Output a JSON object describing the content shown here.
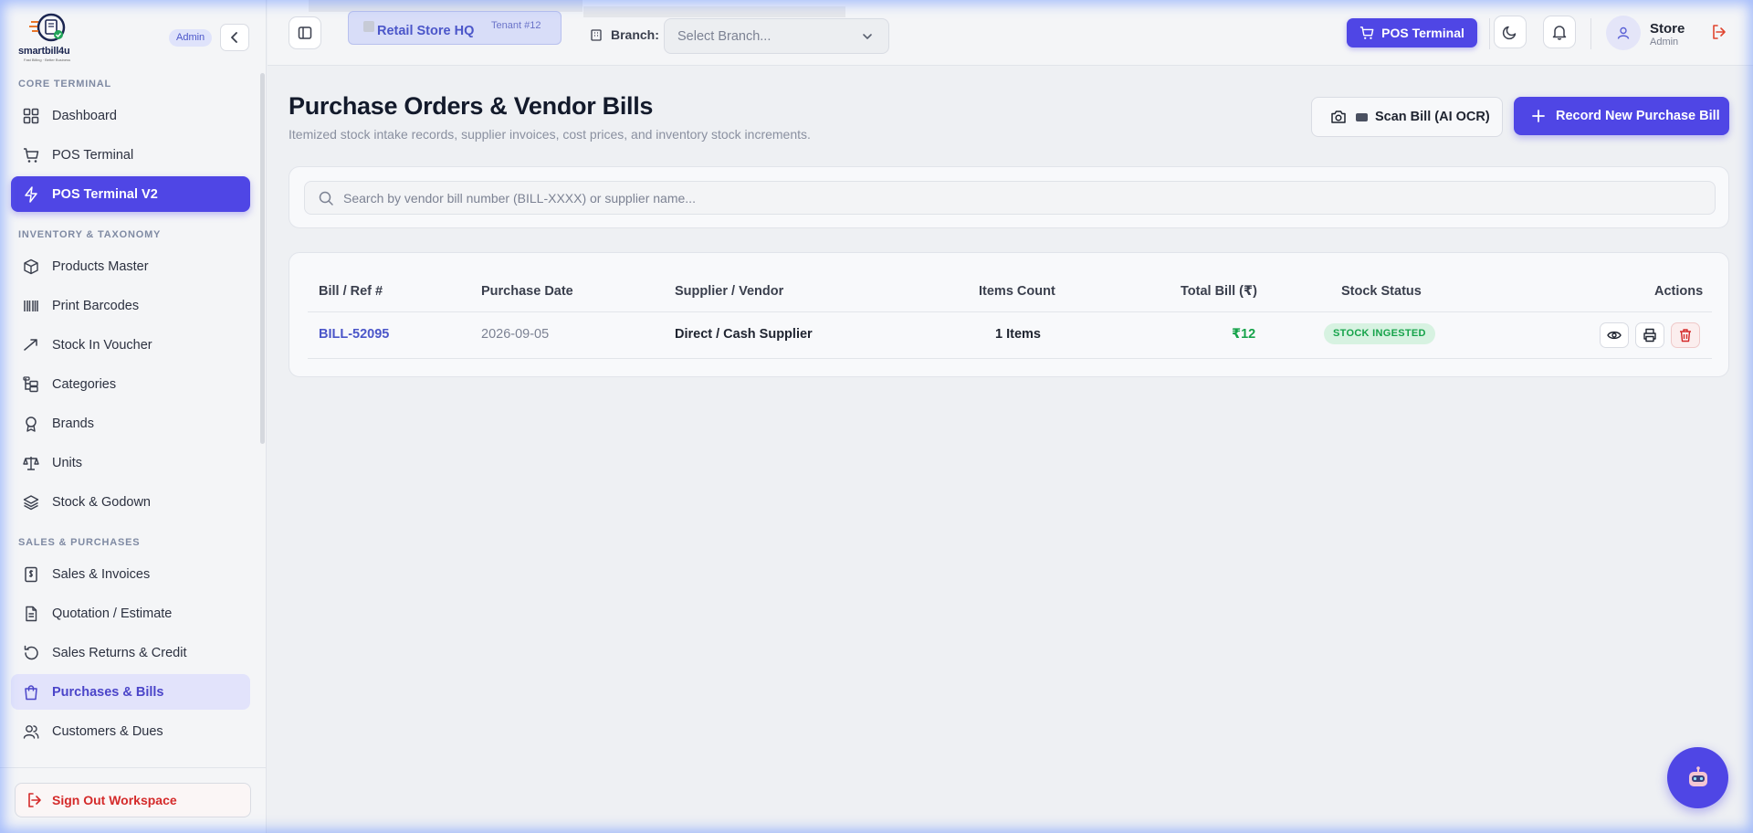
{
  "brand": {
    "name": "smartbill4u",
    "tagline": "Fast Billing · Better Business",
    "role_badge": "Admin"
  },
  "sidebar": {
    "sections": [
      {
        "title": "CORE TERMINAL",
        "items": [
          {
            "label": "Dashboard",
            "icon": "dashboard-icon"
          },
          {
            "label": "POS Terminal",
            "icon": "cart-icon"
          },
          {
            "label": "POS Terminal V2",
            "icon": "bolt-icon",
            "state": "active"
          }
        ]
      },
      {
        "title": "INVENTORY & TAXONOMY",
        "items": [
          {
            "label": "Products Master",
            "icon": "box-icon"
          },
          {
            "label": "Print Barcodes",
            "icon": "barcode-icon"
          },
          {
            "label": "Stock In Voucher",
            "icon": "trend-icon"
          },
          {
            "label": "Categories",
            "icon": "tree-icon"
          },
          {
            "label": "Brands",
            "icon": "award-icon"
          },
          {
            "label": "Units",
            "icon": "scale-icon"
          },
          {
            "label": "Stock & Godown",
            "icon": "layers-icon"
          }
        ]
      },
      {
        "title": "SALES & PURCHASES",
        "items": [
          {
            "label": "Sales & Invoices",
            "icon": "receipt-icon"
          },
          {
            "label": "Quotation / Estimate",
            "icon": "document-icon"
          },
          {
            "label": "Sales Returns & Credit",
            "icon": "return-icon"
          },
          {
            "label": "Purchases & Bills",
            "icon": "bag-icon",
            "state": "current"
          },
          {
            "label": "Customers & Dues",
            "icon": "users-icon"
          }
        ]
      }
    ],
    "signout_label": "Sign Out Workspace"
  },
  "topbar": {
    "store_name": "Retail Store HQ",
    "tenant": "Tenant #12",
    "branch_label": "Branch:",
    "branch_placeholder": "Select Branch...",
    "pos_button": "POS Terminal",
    "user_name": "Store",
    "user_role": "Admin"
  },
  "page": {
    "title": "Purchase Orders & Vendor Bills",
    "subtitle": "Itemized stock intake records, supplier invoices, cost prices, and inventory stock increments.",
    "scan_button": "Scan Bill (AI OCR)",
    "record_button": "Record New Purchase Bill",
    "search_placeholder": "Search by vendor bill number (BILL-XXXX) or supplier name..."
  },
  "table": {
    "headers": {
      "bill_ref": "Bill / Ref #",
      "date": "Purchase Date",
      "vendor": "Supplier / Vendor",
      "items": "Items Count",
      "total": "Total Bill (₹)",
      "status": "Stock Status",
      "actions": "Actions"
    },
    "rows": [
      {
        "bill_ref": "BILL-52095",
        "date": "2026-09-05",
        "vendor": "Direct / Cash Supplier",
        "items": "1 Items",
        "total": "₹12",
        "status": "STOCK INGESTED"
      }
    ]
  },
  "colors": {
    "accent": "#4f46e5",
    "success": "#16a34a",
    "danger": "#d42a2a"
  }
}
